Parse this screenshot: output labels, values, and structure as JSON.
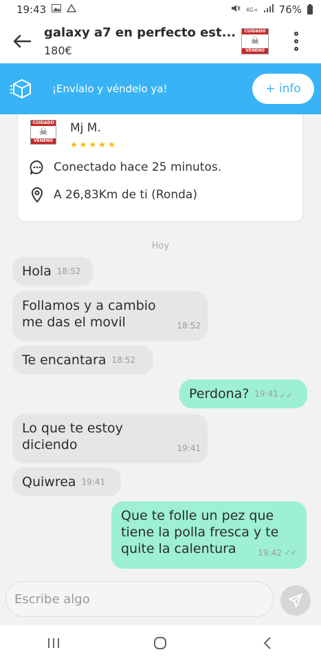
{
  "status_bar": {
    "time": "19:43",
    "network": "4G+",
    "battery": "76%"
  },
  "header": {
    "title": "galaxy a7 en perfecto est...",
    "price": "180€"
  },
  "banner": {
    "text": "¡Envíalo y véndelo ya!",
    "info_label": "+ info"
  },
  "logo": {
    "top_text": "CUIDADO",
    "bottom_text": "VENENO"
  },
  "seller": {
    "name": "Mj M.",
    "rating": 5,
    "rating_max": 5,
    "online_status": "Conectado hace 25 minutos.",
    "location": "A 26,83Km de ti (Ronda)"
  },
  "chat": {
    "date_label": "Hoy",
    "messages": [
      {
        "direction": "in",
        "text": "Hola",
        "time": "18:52"
      },
      {
        "direction": "in",
        "text_lines": [
          "Follamos y a cambio",
          "me das el movil"
        ],
        "time": "18:52"
      },
      {
        "direction": "in",
        "text": "Te encantara",
        "time": "18:52"
      },
      {
        "direction": "out",
        "text": "Perdona?",
        "time": "19:41"
      },
      {
        "direction": "in",
        "text_lines": [
          "Lo que te estoy",
          "diciendo"
        ],
        "time": "19:41"
      },
      {
        "direction": "in",
        "text": "Quiwrea",
        "time": "19:41"
      },
      {
        "direction": "out",
        "text_lines": [
          "Que te folle un pez que",
          "tiene la polla fresca y te",
          "quite la calentura"
        ],
        "time": "19:42"
      }
    ]
  },
  "composer": {
    "placeholder": "Escribe algo"
  },
  "colors": {
    "banner": "#38b3f5",
    "outgoing_bubble": "#9ef0d3",
    "incoming_bubble": "#e6e6e6",
    "star": "#f5b800",
    "logo_red": "#c62828"
  }
}
